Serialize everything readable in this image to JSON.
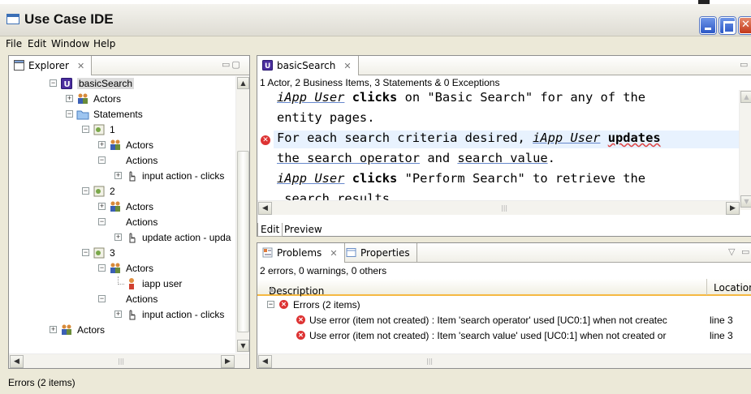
{
  "window": {
    "title": "Use Case IDE"
  },
  "menu": [
    "File",
    "Edit",
    "Window",
    "Help"
  ],
  "explorer": {
    "tab_label": "Explorer",
    "tree": [
      {
        "label": "basicSearch",
        "level": 0
      },
      {
        "label": "Actors",
        "level": 1
      },
      {
        "label": "Statements",
        "level": 1
      },
      {
        "label": "1",
        "level": 2
      },
      {
        "label": "Actors",
        "level": 3
      },
      {
        "label": "Actions",
        "level": 3
      },
      {
        "label": "input action - clicks",
        "level": 4
      },
      {
        "label": "2",
        "level": 2
      },
      {
        "label": "Actors",
        "level": 3
      },
      {
        "label": "Actions",
        "level": 3
      },
      {
        "label": "update action - upda",
        "level": 4
      },
      {
        "label": "3",
        "level": 2
      },
      {
        "label": "Actors",
        "level": 3
      },
      {
        "label": "iapp user",
        "level": 4
      },
      {
        "label": "Actions",
        "level": 3
      },
      {
        "label": "input action - clicks",
        "level": 4
      },
      {
        "label": "Actors",
        "level": 0
      }
    ]
  },
  "editor": {
    "tab_label": "basicSearch",
    "summary": "1 Actor, 2 Business Items, 3 Statements & 0 Exceptions",
    "lines": {
      "l1a": "iApp User",
      "l1b": " ",
      "l1c": "clicks",
      "l1d": " on \"Basic Search\" for any of the",
      "l2": "entity pages.",
      "l3a": "For each search criteria desired, ",
      "l3b": "iApp User",
      "l3c": " ",
      "l3d": "updates",
      "l4a": "the search operator",
      "l4b": " and ",
      "l4c": "search value",
      "l4d": ".",
      "l5a": "iApp User",
      "l5b": " ",
      "l5c": "clicks",
      "l5d": " \"Perform Search\" to retrieve the",
      "l6": " search results."
    },
    "bottom_tabs": {
      "edit": "Edit",
      "preview": "Preview"
    }
  },
  "problems": {
    "tab_label": "Problems",
    "properties_label": "Properties",
    "count": "2 errors, 0 warnings, 0 others",
    "columns": {
      "description": "Description",
      "location": "Location"
    },
    "group": "Errors (2 items)",
    "rows": [
      {
        "description": "Use error (item not created) :  Item 'search operator' used [UC0:1] when not createc",
        "location": "line 3"
      },
      {
        "description": "Use error (item not created) :  Item 'search value' used [UC0:1] when not created or",
        "location": "line 3"
      }
    ]
  },
  "status": "Errors (2 items)",
  "colors": {
    "error": "#dd3333",
    "selection": "#e8f2fe",
    "accent": "#f5b942"
  }
}
